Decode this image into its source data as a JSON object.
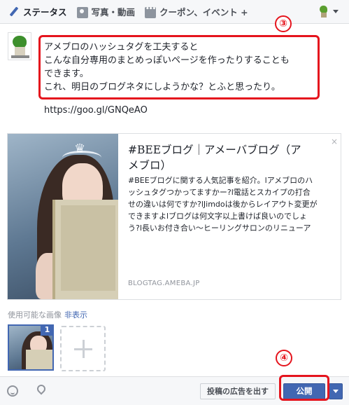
{
  "tabs": [
    {
      "label": "ステータス",
      "icon": "pencil-icon"
    },
    {
      "label": "写真・動画",
      "icon": "camera-icon"
    },
    {
      "label": "クーポン、イベント +",
      "icon": "more-icon"
    }
  ],
  "post": {
    "lines": [
      "アメブロのハッシュタグを工夫すると",
      "こんな自分専用のまとめっぽいページを作ったりすることも",
      "できます。",
      "これ、明日のブログネタにしようかな？とふと思ったり。"
    ],
    "link": "https://goo.gl/GNQeAO"
  },
  "annotations": {
    "step3": "③",
    "step4": "④"
  },
  "card": {
    "title": "#BEEブログ｜アメーバブログ（アメブロ）",
    "title_lines": [
      "#BEEブログ｜アメーバブログ（ア",
      "メブロ）"
    ],
    "description_lines": [
      "#BEEブログに関する人気記事を紹介。lアメブロのハ",
      "ッシュタグつかってますかー?l電話とスカイプの打合",
      "せの違いは何ですか?lJimdoは後からレイアウト変更が",
      "できますよlブログは何文字以上書けば良いのでしょ",
      "う?l長いお付き合い〜ヒーリングサロンのリニューア"
    ],
    "domain": "BLOGTAG.AMEBA.JP",
    "close": "×"
  },
  "images": {
    "label": "使用可能な画像",
    "hide": "非表示",
    "selected_count": "1"
  },
  "footer": {
    "ad_button": "投稿の広告を出す",
    "publish_button": "公開"
  },
  "colors": {
    "accent": "#4267b2",
    "annotation": "#e5141d"
  }
}
